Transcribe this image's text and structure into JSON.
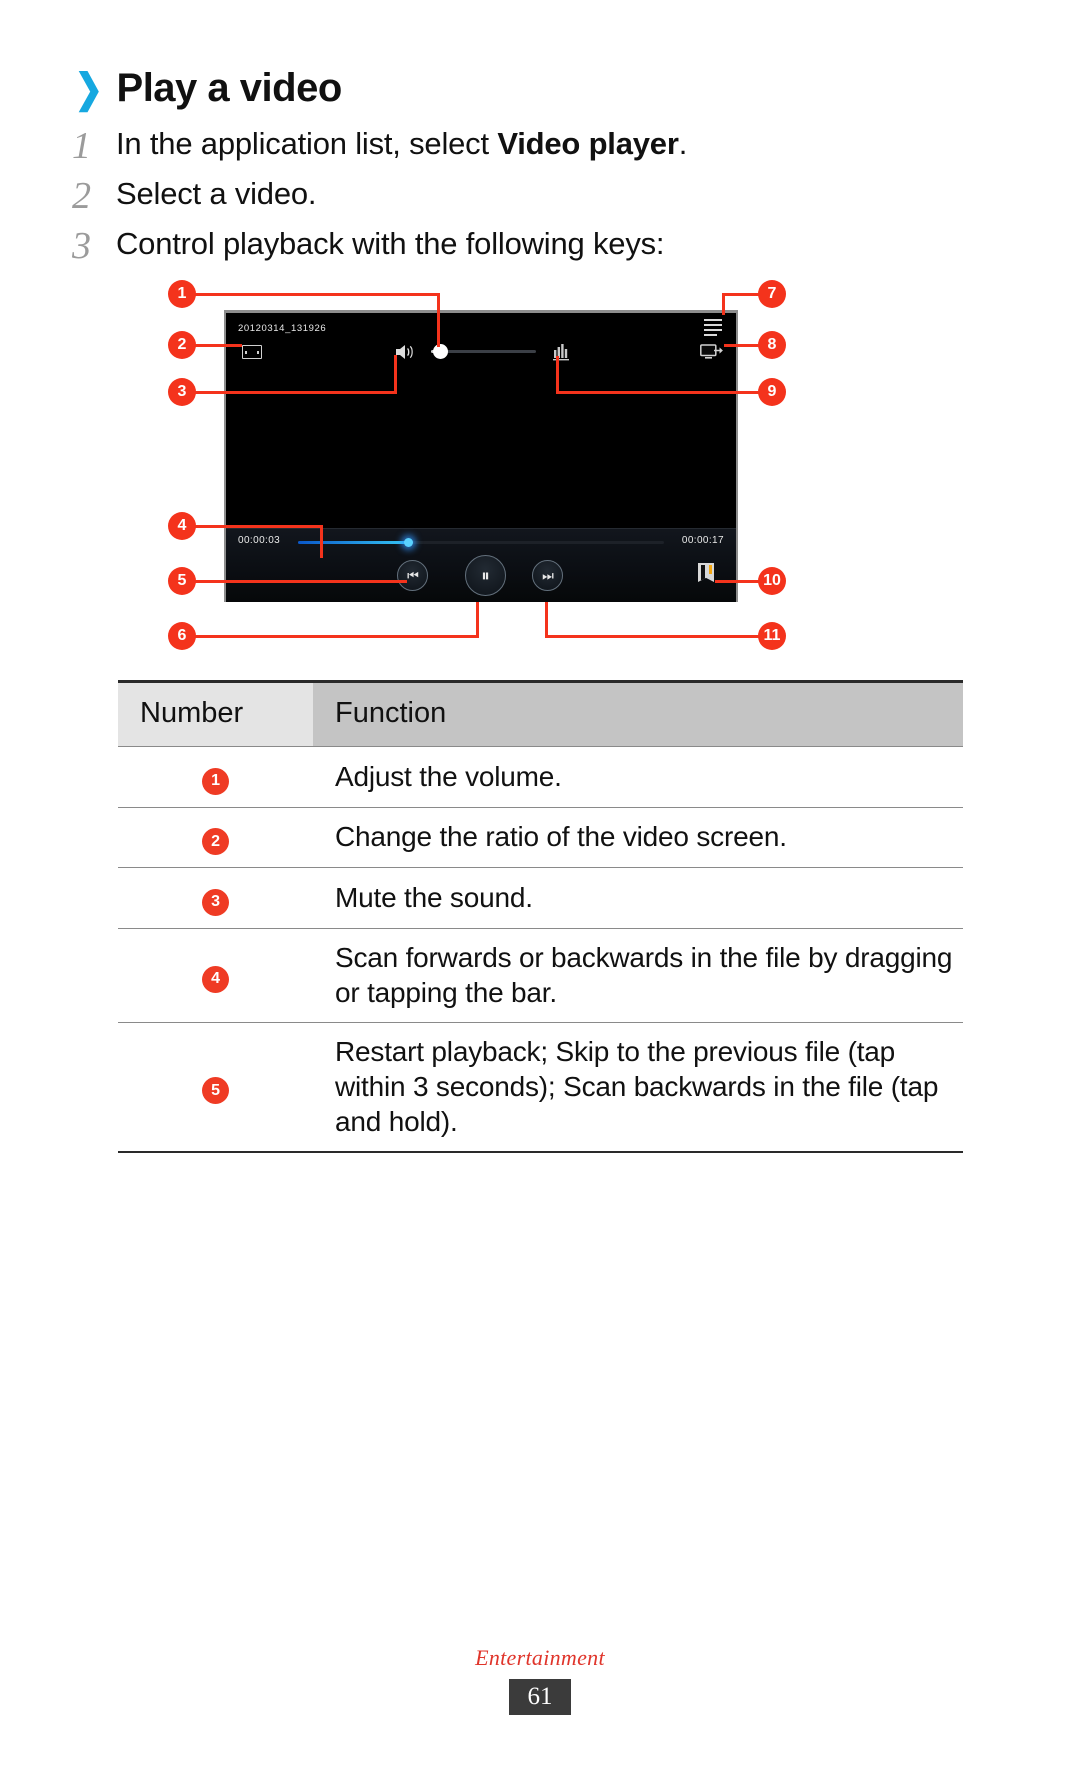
{
  "heading": {
    "chevron": "❯",
    "title": "Play a video"
  },
  "steps": [
    {
      "num": "1",
      "text_before": "In the application list, select ",
      "bold": "Video player",
      "text_after": "."
    },
    {
      "num": "2",
      "text_before": "Select a video.",
      "bold": "",
      "text_after": ""
    },
    {
      "num": "3",
      "text_before": "Control playback with the following keys:",
      "bold": "",
      "text_after": ""
    }
  ],
  "figure": {
    "player": {
      "file_name": "20120314_131926",
      "time_elapsed": "00:00:03",
      "time_total": "00:00:17",
      "progress_percent": 30,
      "volume_percent": 6,
      "icons": {
        "ratio": "screen-ratio-icon",
        "speaker": "speaker-volume-icon",
        "equalizer": "sound-effect-icon",
        "menu": "options-menu-icon",
        "allshare": "allshare-screen-icon",
        "previous": "⏮",
        "play_pause": "⏸",
        "next": "⏭",
        "bookmark": "bookmark-icon"
      }
    },
    "callouts": [
      "1",
      "2",
      "3",
      "4",
      "5",
      "6",
      "7",
      "8",
      "9",
      "10",
      "11"
    ]
  },
  "table": {
    "headers": [
      "Number",
      "Function"
    ],
    "rows": [
      {
        "num": "1",
        "function": "Adjust the volume."
      },
      {
        "num": "2",
        "function": "Change the ratio of the video screen."
      },
      {
        "num": "3",
        "function": "Mute the sound."
      },
      {
        "num": "4",
        "function": "Scan forwards or backwards in the file by dragging or tapping the bar."
      },
      {
        "num": "5",
        "function": "Restart playback; Skip to the previous file (tap within 3 seconds); Scan backwards in the file (tap and hold)."
      }
    ]
  },
  "footer": {
    "section": "Entertainment",
    "page": "61"
  }
}
